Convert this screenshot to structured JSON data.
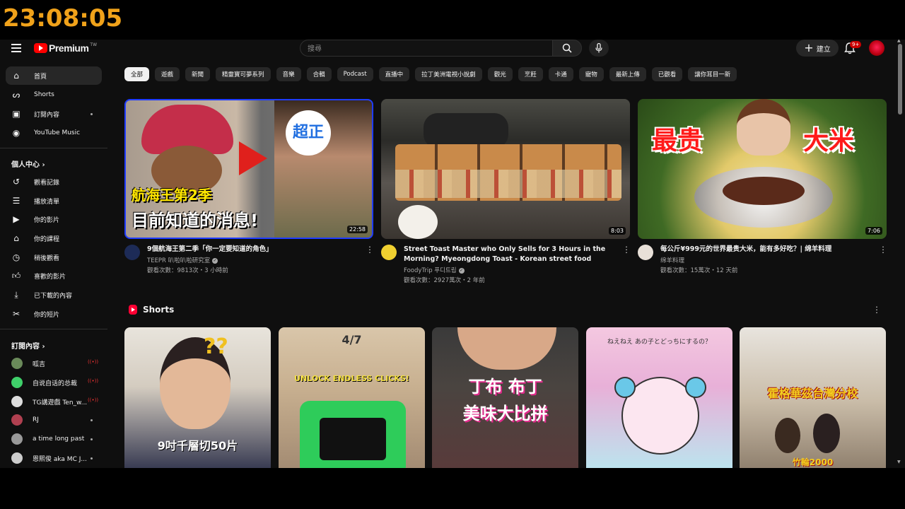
{
  "clock": "23:08:05",
  "header": {
    "brand": "Premium",
    "brand_sup": "TW",
    "search_placeholder": "搜尋",
    "create_label": "建立",
    "notification_badge": "9+"
  },
  "sidebar": {
    "main": [
      {
        "label": "首頁",
        "icon": "home-icon",
        "active": true
      },
      {
        "label": "Shorts",
        "icon": "shorts-icon"
      },
      {
        "label": "訂閱內容",
        "icon": "subscriptions-icon"
      },
      {
        "label": "YouTube Music",
        "icon": "music-icon"
      }
    ],
    "you_header": "個人中心",
    "you": [
      {
        "label": "觀看記錄",
        "icon": "history-icon"
      },
      {
        "label": "播放清單",
        "icon": "playlists-icon"
      },
      {
        "label": "你的影片",
        "icon": "your-videos-icon"
      },
      {
        "label": "你的課程",
        "icon": "courses-icon"
      },
      {
        "label": "稍後觀看",
        "icon": "watch-later-icon"
      },
      {
        "label": "喜歡的影片",
        "icon": "liked-icon"
      },
      {
        "label": "已下載的內容",
        "icon": "downloads-icon"
      },
      {
        "label": "你的短片",
        "icon": "clips-icon"
      }
    ],
    "subs_header": "訂閱內容",
    "subs": [
      {
        "label": "呱吉",
        "status": "live"
      },
      {
        "label": "自说自话的总裁",
        "status": "live"
      },
      {
        "label": "TG講遊戲 Ten_w...",
        "status": "live"
      },
      {
        "label": "RJ",
        "status": "new"
      },
      {
        "label": "a time long past",
        "status": "new"
      },
      {
        "label": "恩熙俊 aka MC J...",
        "status": "new"
      }
    ]
  },
  "chips": [
    "全部",
    "遊戲",
    "新聞",
    "精靈寶可夢系列",
    "音樂",
    "合輯",
    "Podcast",
    "直播中",
    "拉丁美洲電視小說劇",
    "觀光",
    "烹飪",
    "卡通",
    "寵物",
    "最新上傳",
    "已觀看",
    "讓你耳目一新"
  ],
  "videos": [
    {
      "title": "9個航海王第二季「你一定要知道的角色」",
      "channel": "TEEPR 叭啦叭啦研究室",
      "verified": true,
      "stats": "觀看次數：9813次・3 小時前",
      "duration": "22:58",
      "thumb_text_1": "超正",
      "thumb_text_2": "航海王第2季",
      "thumb_text_3": "目前知道的消息!"
    },
    {
      "title": "Street Toast Master who Only Sells for 3 Hours in the Morning? Myeongdong Toast - Korean street food",
      "channel": "FoodyTrip 푸디트립",
      "verified": true,
      "stats": "觀看次數：2927萬次・2 年前",
      "duration": "8:03"
    },
    {
      "title": "每公斤¥999元的世界最贵大米，能有多好吃？| 绵羊料理",
      "channel": "绵羊料理",
      "verified": false,
      "stats": "觀看次數：15萬次・12 天前",
      "duration": "7:06",
      "thumb_text_1": "最贵",
      "thumb_text_2": "大米"
    }
  ],
  "shorts": {
    "title": "Shorts",
    "items": [
      {
        "caption": "9吋千層切50片"
      },
      {
        "caption_top": "4/7",
        "caption": "UNLOCK ENDLESS CLICKS!"
      },
      {
        "caption": "丁布 布丁",
        "caption_2": "美味大比拼"
      },
      {
        "caption": "ねえねえ あの子とどっちにするの？"
      },
      {
        "caption": "霍格華茲台灣分校",
        "caption_2": "竹輪2000"
      }
    ]
  },
  "colors": {
    "accent": "#ff0000",
    "clock": "#f0a21a",
    "bg": "#0f0f0f"
  }
}
